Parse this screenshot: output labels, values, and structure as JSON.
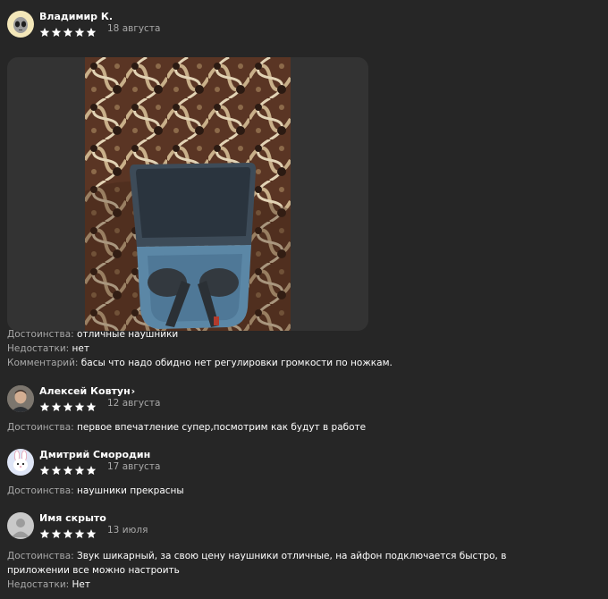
{
  "reviews": [
    {
      "author": "Владимир К.",
      "date": "18 августа",
      "rating": 5,
      "avatar_icon": "alien-face-icon",
      "pros_label": "Достоинства:",
      "pros": "отличные наушники",
      "cons_label": "Недостатки:",
      "cons": "нет",
      "comment_label": "Комментарий:",
      "comment": "басы что надо обидно нет регулировки громкости по ножкам."
    },
    {
      "author": "Алексей Ковтун",
      "author_chevron": "›",
      "date": "12 августа",
      "rating": 5,
      "pros_label": "Достоинства:",
      "pros": "первое впечатление супер,посмотрим как будут в работе"
    },
    {
      "author": "Дмитрий Смородин",
      "date": "17 августа",
      "rating": 5,
      "avatar_icon": "bunny-face-icon",
      "pros_label": "Достоинства:",
      "pros": "наушники прекрасны"
    },
    {
      "author": "Имя скрыто",
      "date": "13 июля",
      "rating": 5,
      "avatar_icon": "anonymous-user-icon",
      "pros_label": "Достоинства:",
      "pros_line1": "Звук шикарный, за свою цену наушники отличные, на айфон подключается быстро, в",
      "pros_line2": "приложении все можно настроить",
      "cons_label": "Недостатки:",
      "cons": "Нет"
    }
  ],
  "colors": {
    "background": "#262626",
    "star": "#ffffff",
    "label": "#a8a8a8",
    "media_bg": "#333333"
  }
}
